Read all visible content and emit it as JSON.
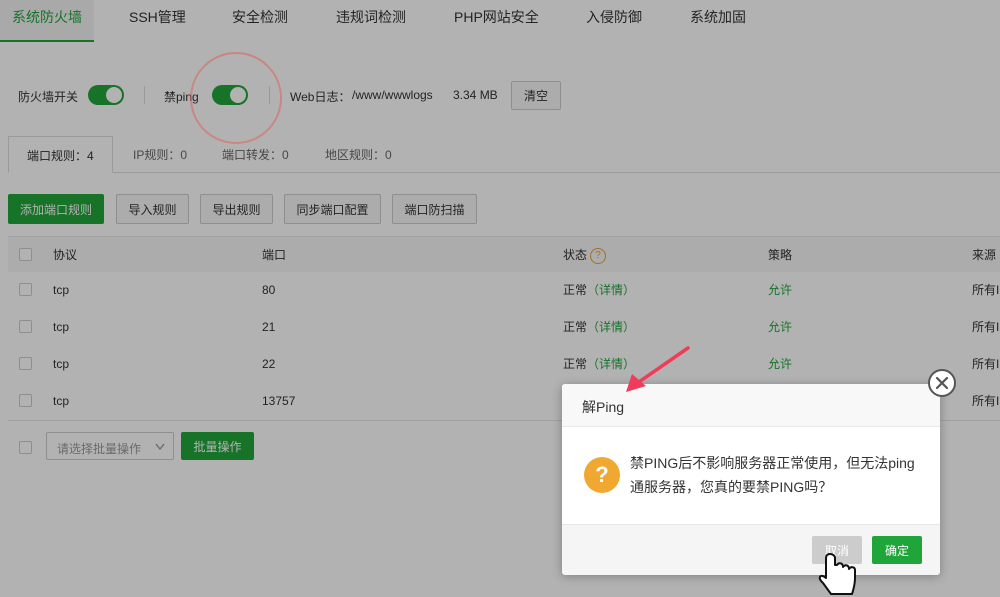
{
  "topnav": {
    "tabs": [
      "系统防火墙",
      "SSH管理",
      "安全检测",
      "违规词检测",
      "PHP网站安全",
      "入侵防御",
      "系统加固"
    ]
  },
  "toolbar": {
    "firewall_switch_label": "防火墙开关",
    "firewall_switch_on": true,
    "ping_switch_label": "禁ping",
    "ping_switch_on": true,
    "weblog_label": "Web日志：",
    "weblog_path": "/www/wwwlogs",
    "weblog_size": "3.34 MB",
    "clear_button": "清空"
  },
  "subtabs": [
    "端口规则：4",
    "IP规则：0",
    "端口转发：0",
    "地区规则：0"
  ],
  "actions": {
    "add_port_rule": "添加端口规则",
    "import_rules": "导入规则",
    "export_rules": "导出规则",
    "sync_port_config": "同步端口配置",
    "port_scan_protection": "端口防扫描"
  },
  "table": {
    "headers": {
      "protocol": "协议",
      "port": "端口",
      "status": "状态",
      "policy": "策略",
      "source": "来源"
    },
    "rows": [
      {
        "protocol": "tcp",
        "port": "80",
        "status": "正常",
        "details": "（详情）",
        "policy": "允许",
        "source": "所有IP"
      },
      {
        "protocol": "tcp",
        "port": "21",
        "status": "正常",
        "details": "（详情）",
        "policy": "允许",
        "source": "所有IP"
      },
      {
        "protocol": "tcp",
        "port": "22",
        "status": "正常",
        "details": "（详情）",
        "policy": "允许",
        "source": "所有IP"
      },
      {
        "protocol": "tcp",
        "port": "13757",
        "status": "",
        "details": "",
        "policy": "",
        "source": "所有IP"
      }
    ]
  },
  "batch": {
    "select_placeholder": "请选择批量操作",
    "batch_button": "批量操作"
  },
  "dialog": {
    "title": "解Ping",
    "message": "禁PING后不影响服务器正常使用，但无法ping通服务器，您真的要禁PING吗？",
    "cancel": "取消",
    "confirm": "确定",
    "close_glyph": "✕",
    "question_glyph": "?"
  },
  "colors": {
    "accent": "#20a53a",
    "warning": "#f0a830",
    "arrow": "#f03c5a"
  },
  "icons": [
    "help-icon",
    "question-icon",
    "close-icon",
    "chevron-down-icon",
    "arrow-pointer-icon",
    "hand-cursor-icon"
  ]
}
